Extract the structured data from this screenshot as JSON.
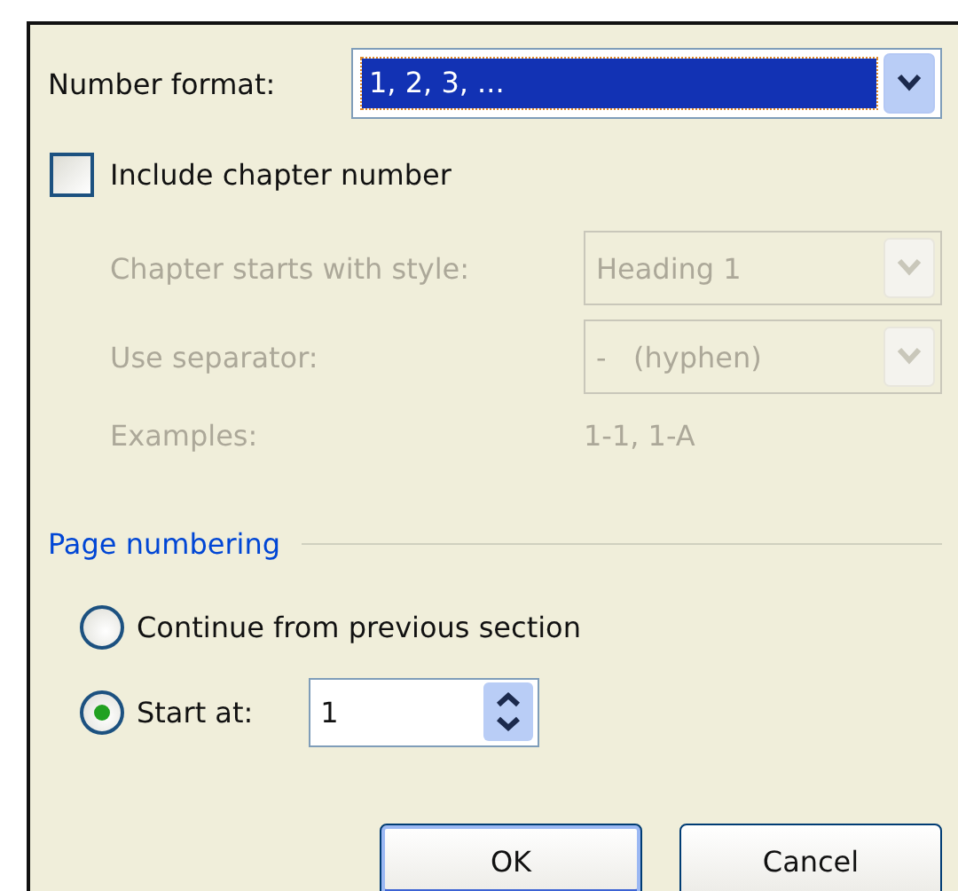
{
  "number_format": {
    "label": "Number format:",
    "value": "1, 2, 3, ...",
    "focused": true
  },
  "include_chapter": {
    "label": "Include chapter number",
    "checked": false
  },
  "chapter_fields": [
    {
      "kind": "dropdown",
      "label": "Chapter starts with style:",
      "value": "Heading 1",
      "disabled": true
    },
    {
      "kind": "dropdown",
      "label": "Use separator:",
      "value": "-   (hyphen)",
      "disabled": true
    },
    {
      "kind": "text",
      "label": "Examples:",
      "value": "1-1, 1-A",
      "disabled": true
    }
  ],
  "page_numbering": {
    "title": "Page numbering",
    "options": [
      {
        "label": "Continue from previous section",
        "selected": false
      },
      {
        "label": "Start at:",
        "selected": true
      }
    ],
    "start_at": "1"
  },
  "buttons": [
    {
      "label": "OK",
      "default": true
    },
    {
      "label": "Cancel",
      "default": false
    }
  ]
}
